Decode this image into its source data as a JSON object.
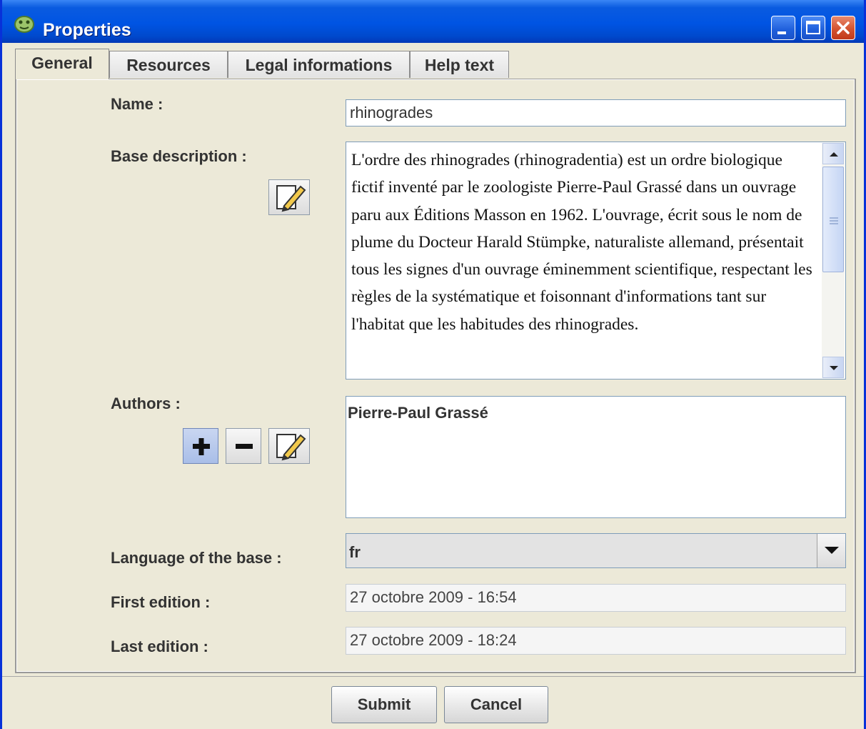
{
  "window": {
    "title": "Properties",
    "icons": {
      "app": "bug-app-icon",
      "minimize": "minimize-icon",
      "maximize": "maximize-icon",
      "close": "close-icon"
    }
  },
  "tabs": [
    {
      "label": "General",
      "active": true
    },
    {
      "label": "Resources",
      "active": false
    },
    {
      "label": "Legal informations",
      "active": false
    },
    {
      "label": "Help text",
      "active": false
    }
  ],
  "form": {
    "name_label": "Name :",
    "name_value": "rhinogrades",
    "description_label": "Base description :",
    "description_text": "L'ordre des rhinogrades (rhinogradentia) est un ordre biologique fictif inventé par le zoologiste Pierre-Paul Grassé dans un ouvrage paru aux Éditions Masson en 1962. L'ouvrage, écrit sous le nom de plume du Docteur Harald Stümpke, naturaliste allemand, présentait tous les signes d'un ouvrage éminemment scientifique, respectant les règles de la systématique et foisonnant d'informations tant sur l'habitat que les habitudes des rhinogrades.",
    "authors_label": "Authors :",
    "authors": [
      "Pierre-Paul Grassé"
    ],
    "language_label": "Language of the base :",
    "language_value": "fr",
    "first_edition_label": "First edition :",
    "first_edition_value": "27 octobre 2009 - 16:54",
    "last_edition_label": "Last edition :",
    "last_edition_value": "27 octobre 2009 - 18:24",
    "icons": {
      "edit": "edit-pencil-icon",
      "add": "plus-icon",
      "remove": "minus-icon",
      "dropdown": "chevron-down-icon"
    }
  },
  "buttons": {
    "submit": "Submit",
    "cancel": "Cancel"
  },
  "colors": {
    "titlebar": "#0054E3",
    "window_bg": "#ECE9D8",
    "close": "#D3532F"
  }
}
